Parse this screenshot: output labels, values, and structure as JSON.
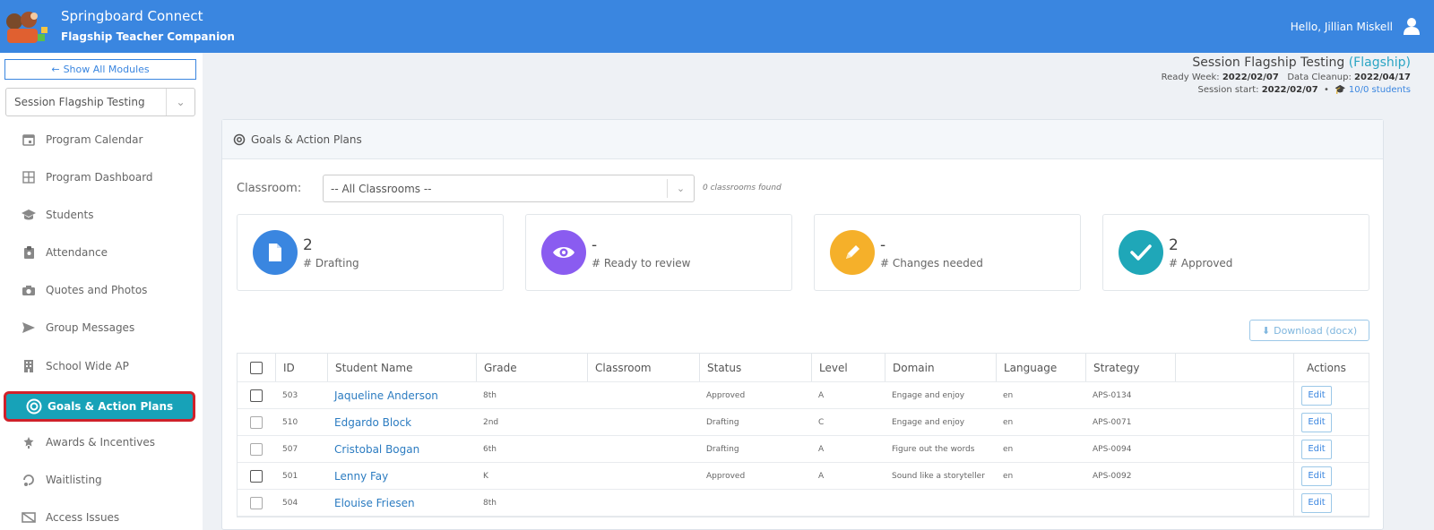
{
  "header": {
    "app_title": "Springboard Connect",
    "app_subtitle": "Flagship Teacher Companion",
    "greeting": "Hello, Jillian Miskell"
  },
  "sidebar": {
    "show_all_label": "Show All Modules",
    "session_select": "Session Flagship Testing",
    "items": [
      {
        "label": "Program Calendar",
        "icon": "calendar-icon"
      },
      {
        "label": "Program Dashboard",
        "icon": "dashboard-icon"
      },
      {
        "label": "Students",
        "icon": "graduation-cap-icon"
      },
      {
        "label": "Attendance",
        "icon": "clipboard-icon"
      },
      {
        "label": "Quotes and Photos",
        "icon": "camera-icon"
      },
      {
        "label": "Group Messages",
        "icon": "paper-plane-icon"
      },
      {
        "label": "School Wide AP",
        "icon": "building-icon"
      },
      {
        "label": "Goals & Action Plans",
        "icon": "target-icon",
        "active": true
      },
      {
        "label": "Awards & Incentives",
        "icon": "award-icon"
      },
      {
        "label": "Waitlisting",
        "icon": "waitlist-icon"
      },
      {
        "label": "Access Issues",
        "icon": "access-icon"
      }
    ]
  },
  "session": {
    "title": "Session Flagship Testing",
    "tag": "(Flagship)",
    "ready_week_label": "Ready Week:",
    "ready_week": "2022/02/07",
    "cleanup_label": "Data Cleanup:",
    "cleanup": "2022/04/17",
    "start_label": "Session start:",
    "start": "2022/02/07",
    "bullet": "•",
    "students": "10/0 students"
  },
  "panel": {
    "title": "Goals & Action Plans",
    "classroom_label": "Classroom:",
    "classroom_value": "-- All Classrooms --",
    "classroom_count": "0 classrooms found",
    "download_label": "Download (docx)"
  },
  "stats": [
    {
      "value": "2",
      "label": "# Drafting",
      "color": "#3a86e0",
      "icon": "file-icon"
    },
    {
      "value": "-",
      "label": "# Ready to review",
      "color": "#8a5cf0",
      "icon": "eye-icon"
    },
    {
      "value": "-",
      "label": "# Changes needed",
      "color": "#f5b02a",
      "icon": "pencil-icon"
    },
    {
      "value": "2",
      "label": "# Approved",
      "color": "#1fa7b8",
      "icon": "check-icon"
    }
  ],
  "table": {
    "columns": [
      "ID",
      "Student Name",
      "Grade",
      "Classroom",
      "Status",
      "Level",
      "Domain",
      "Language",
      "Strategy",
      "Actions"
    ],
    "edit_label": "Edit",
    "rows": [
      {
        "id": "503",
        "name": "Jaqueline Anderson",
        "grade": "8th",
        "classroom": "",
        "status": "Approved",
        "level": "A",
        "domain": "Engage and enjoy",
        "language": "en",
        "strategy": "APS-0134"
      },
      {
        "id": "510",
        "name": "Edgardo Block",
        "grade": "2nd",
        "classroom": "",
        "status": "Drafting",
        "level": "C",
        "domain": "Engage and enjoy",
        "language": "en",
        "strategy": "APS-0071"
      },
      {
        "id": "507",
        "name": "Cristobal Bogan",
        "grade": "6th",
        "classroom": "",
        "status": "Drafting",
        "level": "A",
        "domain": "Figure out the words",
        "language": "en",
        "strategy": "APS-0094"
      },
      {
        "id": "501",
        "name": "Lenny Fay",
        "grade": "K",
        "classroom": "",
        "status": "Approved",
        "level": "A",
        "domain": "Sound like a storyteller",
        "language": "en",
        "strategy": "APS-0092"
      },
      {
        "id": "504",
        "name": "Elouise Friesen",
        "grade": "8th",
        "classroom": "",
        "status": "",
        "level": "",
        "domain": "",
        "language": "",
        "strategy": ""
      }
    ]
  }
}
